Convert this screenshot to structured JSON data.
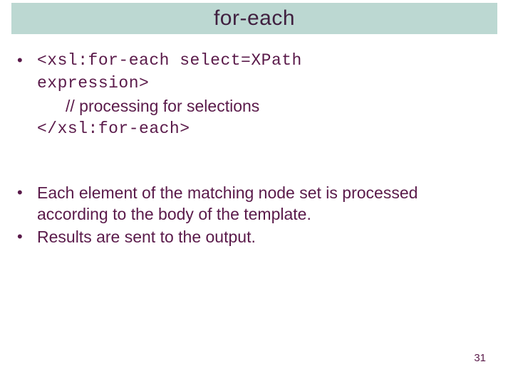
{
  "title": "for-each",
  "code": {
    "line1": "<xsl:for-each select=XPath",
    "line2": "expression>",
    "line3": "// processing for selections",
    "line4": "</xsl:for-each>"
  },
  "bullets": {
    "b1": "Each element of the matching node set is processed according to the body of the template.",
    "b2": "Results are sent to the output."
  },
  "pageNumber": "31"
}
